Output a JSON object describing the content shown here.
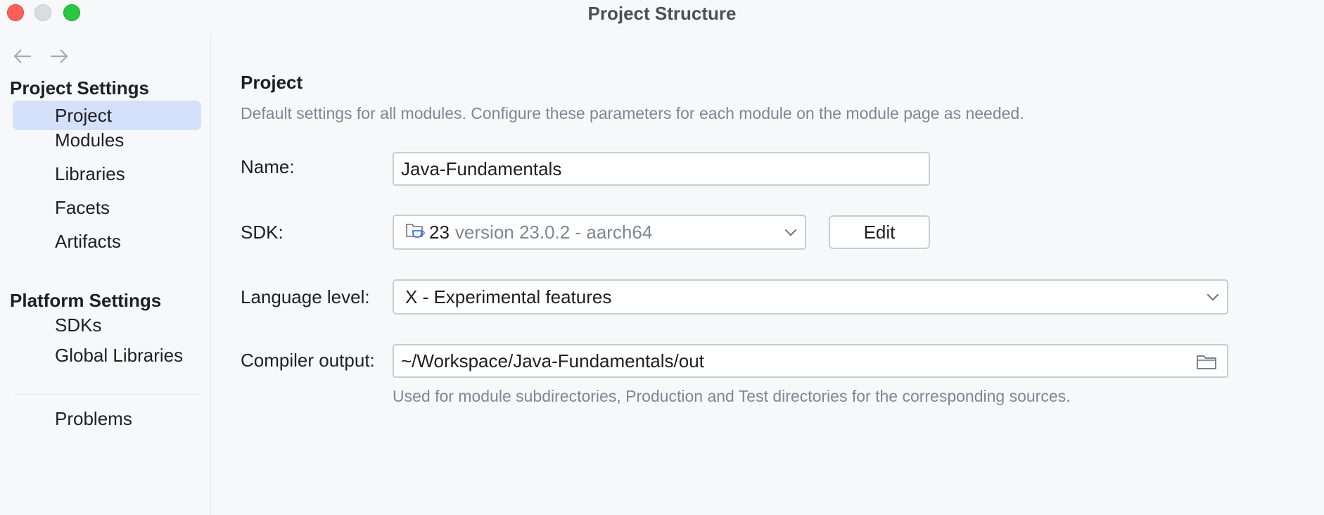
{
  "window": {
    "title": "Project Structure"
  },
  "sidebar": {
    "back_icon": "arrow-left-icon",
    "forward_icon": "arrow-right-icon",
    "groups": [
      {
        "header": "Project Settings",
        "items": [
          {
            "label": "Project",
            "selected": true
          },
          {
            "label": "Modules"
          },
          {
            "label": "Libraries"
          },
          {
            "label": "Facets"
          },
          {
            "label": "Artifacts"
          }
        ]
      },
      {
        "header": "Platform Settings",
        "items": [
          {
            "label": "SDKs"
          },
          {
            "label": "Global Libraries"
          }
        ]
      }
    ],
    "problems_label": "Problems",
    "selection_color": "#d5e0fa"
  },
  "main": {
    "title": "Project",
    "description": "Default settings for all modules. Configure these parameters for each module on the module page as needed.",
    "name": {
      "label": "Name:",
      "value": "Java-Fundamentals"
    },
    "sdk": {
      "label": "SDK:",
      "name": "23",
      "detail": "version 23.0.2 - aarch64",
      "icon": "java-sdk-folder-icon",
      "edit_label": "Edit"
    },
    "language_level": {
      "label": "Language level:",
      "value": "X - Experimental features"
    },
    "compiler_output": {
      "label": "Compiler output:",
      "value": "~/Workspace/Java-Fundamentals/out",
      "icon": "folder-icon",
      "hint": "Used for module subdirectories, Production and Test directories for the corresponding sources."
    }
  }
}
